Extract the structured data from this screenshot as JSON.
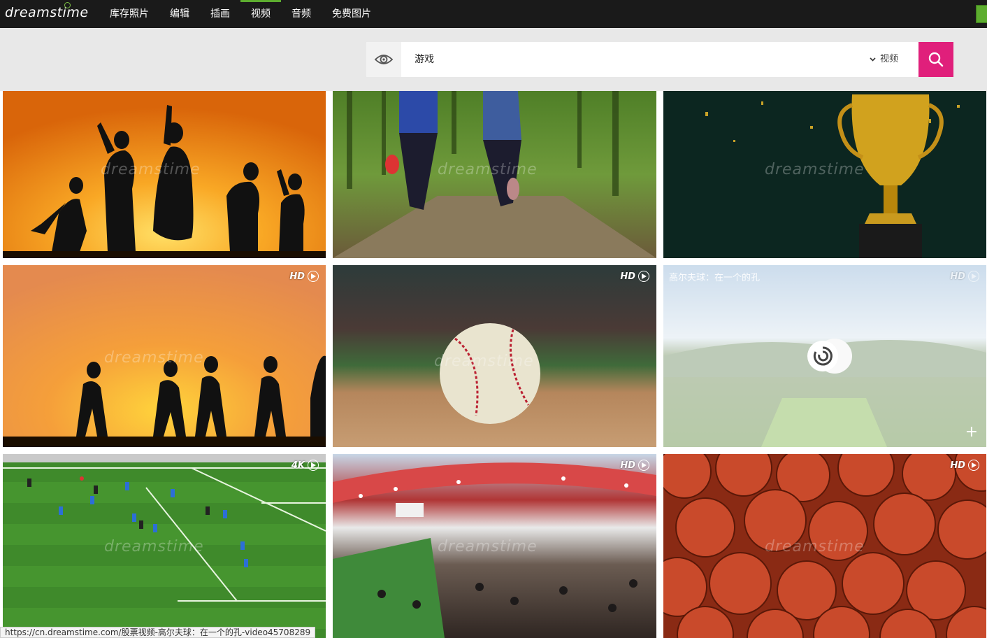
{
  "header": {
    "logo_text": "dreamstime",
    "nav": [
      {
        "label": "库存照片"
      },
      {
        "label": "编辑"
      },
      {
        "label": "插画"
      },
      {
        "label": "视频",
        "active": true
      },
      {
        "label": "音频"
      },
      {
        "label": "免费图片"
      }
    ]
  },
  "search": {
    "query": "游戏",
    "type_label": "视频",
    "icons": {
      "left": "eye-icon",
      "button": "search-icon",
      "select": "chevron-down-icon"
    }
  },
  "tiles": [
    {
      "badge": "",
      "subject": "children silhouettes dancing at sunset"
    },
    {
      "badge": "",
      "subject": "two people running through forest"
    },
    {
      "badge": "",
      "subject": "golden trophy with confetti"
    },
    {
      "badge": "HD",
      "subject": "children running silhouettes at sunset"
    },
    {
      "badge": "HD",
      "subject": "baseball close-up on field"
    },
    {
      "badge": "HD",
      "subject": "golf ball flying toward hole",
      "title": "高尔夫球：在一个的孔",
      "loading": true
    },
    {
      "badge": "4K",
      "subject": "soccer match aerial"
    },
    {
      "badge": "HD",
      "subject": "stadium crowd cheering"
    },
    {
      "badge": "HD",
      "subject": "pile of basketballs"
    }
  ],
  "watermark": "dreamstime",
  "status_bar": {
    "url": "https://cn.dreamstime.com/股票视频-高尔夫球：在一个的孔-video45708289"
  },
  "colors": {
    "topbar": "#1a1a1a",
    "accent_green": "#5dad2f",
    "search_button": "#e01f7b",
    "search_band": "#e8e8e8"
  }
}
